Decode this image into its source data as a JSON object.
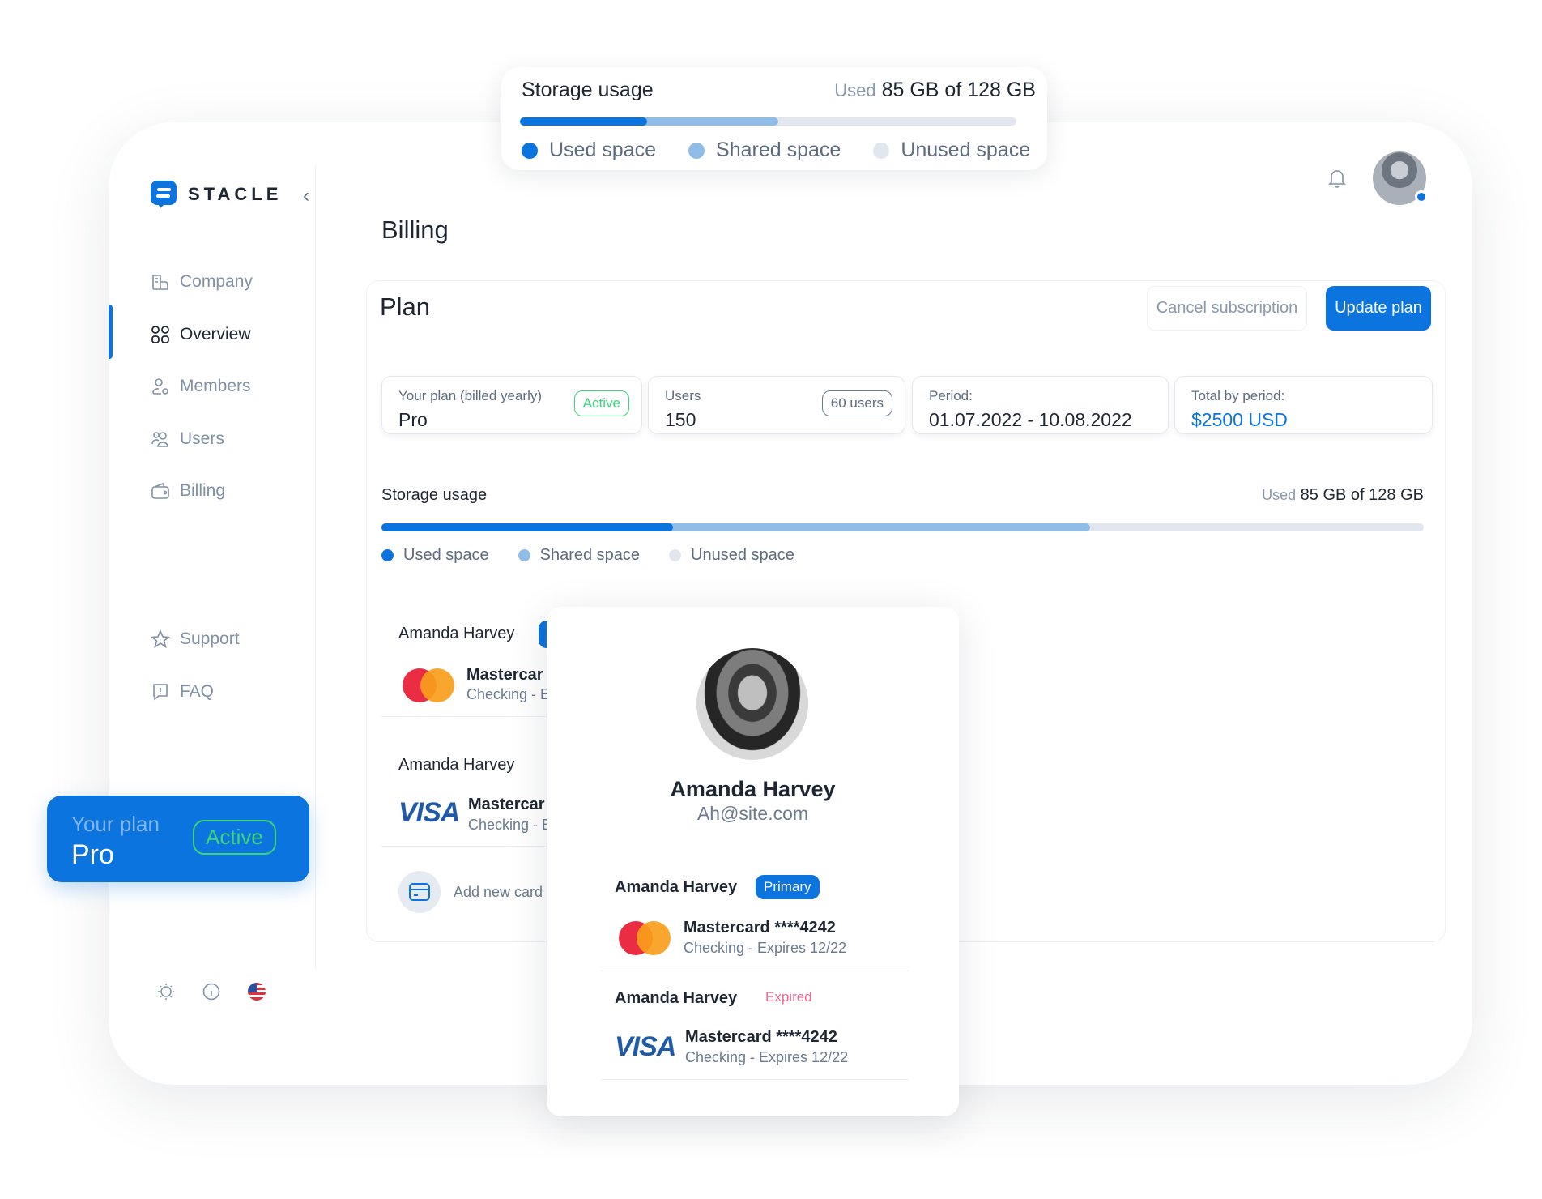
{
  "floating_storage": {
    "title": "Storage usage",
    "used_prefix": "Used",
    "used_value": "85 GB of 128 GB",
    "used_fraction": 0.256,
    "shared_fraction": 0.52,
    "legend": [
      {
        "label": "Used space",
        "color": "#0b74de"
      },
      {
        "label": "Shared space",
        "color": "#90bde8"
      },
      {
        "label": "Unused space",
        "color": "#e2e7ef"
      }
    ]
  },
  "brand": {
    "name": "STACLE",
    "color": "#0b74de"
  },
  "sidebar": {
    "items": [
      {
        "label": "Company",
        "icon": "building-icon"
      },
      {
        "label": "Overview",
        "icon": "grid-icon",
        "active": true
      },
      {
        "label": "Members",
        "icon": "user-gear-icon"
      },
      {
        "label": "Users",
        "icon": "users-icon"
      },
      {
        "label": "Billing",
        "icon": "wallet-icon"
      }
    ],
    "secondary": [
      {
        "label": "Support",
        "icon": "star-icon"
      },
      {
        "label": "FAQ",
        "icon": "question-icon"
      }
    ],
    "footer_icons": [
      "sun-icon",
      "info-icon",
      "us-flag-icon"
    ]
  },
  "plan_badge": {
    "label": "Your plan",
    "plan": "Pro",
    "status": "Active"
  },
  "header": {
    "title": "Billing"
  },
  "plan": {
    "title": "Plan",
    "cancel_label": "Cancel subscription",
    "update_label": "Update plan",
    "cards": [
      {
        "label": "Your plan (billed  yearly)",
        "value": "Pro",
        "badge": "Active"
      },
      {
        "label": "Users",
        "value": "150",
        "badge": "60 users"
      },
      {
        "label": "Period:",
        "value": "01.07.2022 - 10.08.2022"
      },
      {
        "label": "Total by period:",
        "value": "$2500 USD"
      }
    ]
  },
  "storage": {
    "title": "Storage usage",
    "used_prefix": "Used",
    "used_value": "85 GB of 128 GB",
    "used_fraction": 0.28,
    "shared_fraction": 0.68,
    "legend": [
      "Used space",
      "Shared space",
      "Unused space"
    ]
  },
  "cards_list": {
    "items": [
      {
        "holder": "Amanda Harvey",
        "brand": "Mastercard",
        "name": "Mastercar",
        "sub": "Checking - E"
      },
      {
        "holder": "Amanda Harvey",
        "brand": "Visa",
        "name": "Mastercar",
        "sub": "Checking - E"
      }
    ],
    "add_label": "Add new card"
  },
  "profile": {
    "name": "Amanda Harvey",
    "email": "Ah@site.com",
    "cards": [
      {
        "holder": "Amanda Harvey",
        "badge": "Primary",
        "brand": "Mastercard",
        "name": "Mastercard ****4242",
        "sub": "Checking - Expires 12/22"
      },
      {
        "holder": "Amanda Harvey",
        "badge": "Expired",
        "brand": "Visa",
        "name": "Mastercard ****4242",
        "sub": "Checking - Expires 12/22"
      }
    ]
  },
  "visa_text": "VISA"
}
